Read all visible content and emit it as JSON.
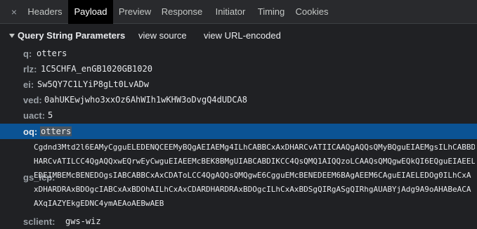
{
  "tabs": {
    "close_icon": "×",
    "items": [
      "Headers",
      "Payload",
      "Preview",
      "Response",
      "Initiator",
      "Timing",
      "Cookies"
    ],
    "active": "Payload"
  },
  "section": {
    "title": "Query String Parameters",
    "view_source": "view source",
    "view_url_encoded": "view URL-encoded"
  },
  "params": [
    {
      "key": "q:",
      "value": "otters"
    },
    {
      "key": "rlz:",
      "value": "1C5CHFA_enGB1020GB1020"
    },
    {
      "key": "ei:",
      "value": "Sw5QY7C1LYiP8gLt0LvADw"
    },
    {
      "key": "ved:",
      "value": "0ahUKEwjwho3xxOz6AhWIh1wKHW3oDvgQ4dUDCA8"
    },
    {
      "key": "uact:",
      "value": "5"
    },
    {
      "key": "oq:",
      "value": "otters"
    }
  ],
  "gs_lcp": {
    "key": "gs_lcp:",
    "lines": [
      "Cgdnd3Mtd2l6EAMyCgguELEDENQCEEMyBQgAEIAEMg4ILhCABBCxAxDHARCvATIICAAQgAQQsQMyBQguEIAEMgsILhCABBD",
      "HARCvATILCC4QgAQQxwEQrwEyCwguEIAEEMcBEK8BMgUIABCABDIKCC4QsQMQ1AIQQzoLCAAQsQMQgwEQkQI6EQguEIAEEL",
      "EDEIMBEMcBENEDOgsIABCABBCxAxCDAToLCC4QgAQQsQMQgwE6CgguEMcBENEDEEM6BAgAEEM6CAguEIAELEDOg0ILhCxA",
      "xDHARDRAxBDOgcIABCxAxBDOhAILhCxAxCDARDHARDRAxBDOgcILhCxAxBDSgQIRgASgQIRhgAUABYjAdg9A9oAHABeACA",
      "AXqIAZYEkgEDNC4ymAEAoAEBwAEB"
    ]
  },
  "next_param": {
    "key": "sclient:",
    "value": "gws-wiz"
  }
}
